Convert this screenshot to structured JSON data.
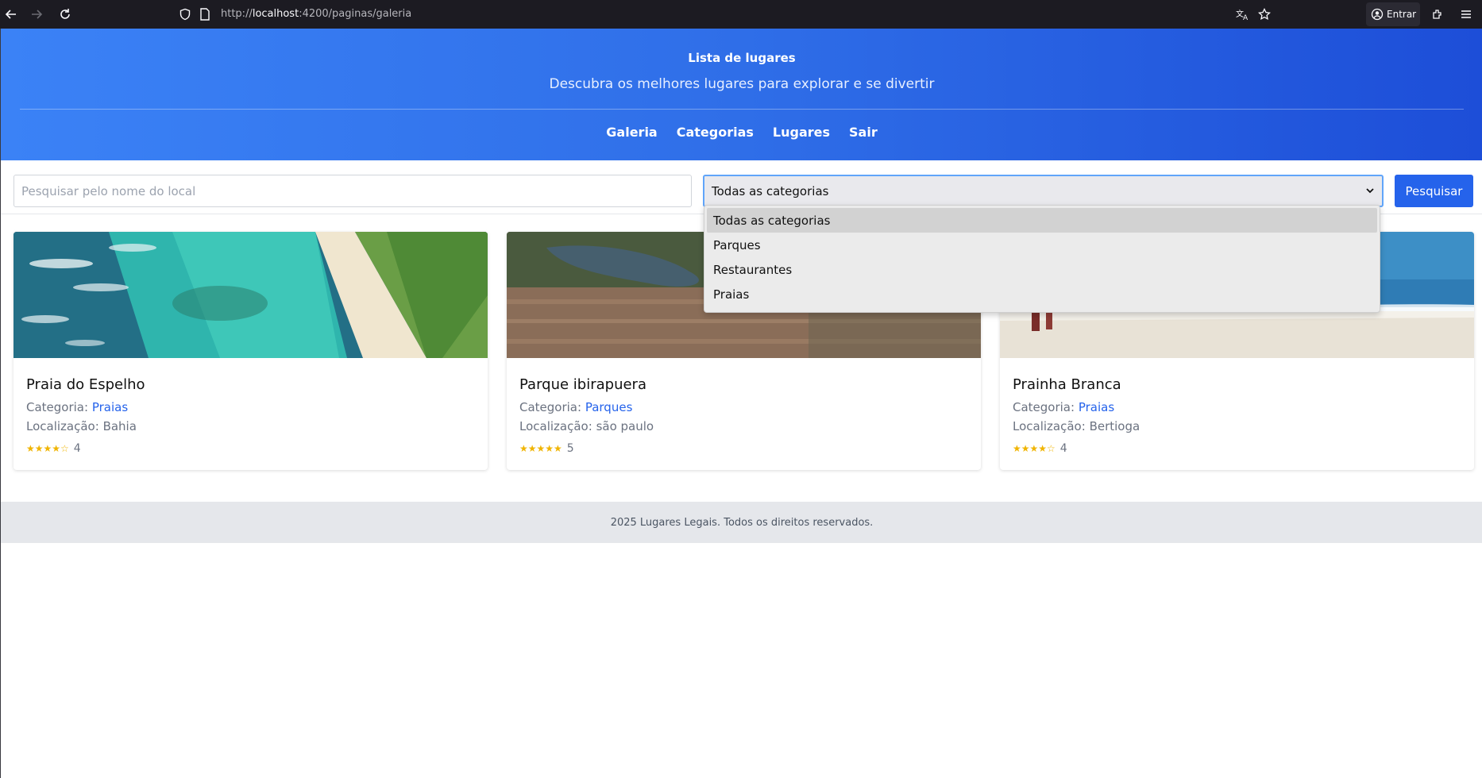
{
  "browser": {
    "url_prefix": "http://",
    "url_host": "localhost",
    "url_rest": ":4200/paginas/galeria",
    "account_label": "Entrar"
  },
  "header": {
    "title": "Lista de lugares",
    "subtitle": "Descubra os melhores lugares para explorar e se divertir",
    "menu": [
      {
        "label": "Galeria"
      },
      {
        "label": "Categorias"
      },
      {
        "label": "Lugares"
      },
      {
        "label": "Sair"
      }
    ]
  },
  "filters": {
    "search_placeholder": "Pesquisar pelo nome do local",
    "category_selected": "Todas as categorias",
    "category_options": [
      "Todas as categorias",
      "Parques",
      "Restaurantes",
      "Praias"
    ],
    "search_button": "Pesquisar"
  },
  "cards": [
    {
      "name": "Praia do Espelho",
      "category_label": "Categoria:",
      "category": "Praias",
      "location_label": "Localização:",
      "location": "Bahia",
      "stars": "★★★★☆",
      "rating": "4"
    },
    {
      "name": "Parque ibirapuera",
      "category_label": "Categoria:",
      "category": "Parques",
      "location_label": "Localização:",
      "location": "são paulo",
      "stars": "★★★★★",
      "rating": "5"
    },
    {
      "name": "Prainha Branca",
      "category_label": "Categoria:",
      "category": "Praias",
      "location_label": "Localização:",
      "location": "Bertioga",
      "stars": "★★★★☆",
      "rating": "4"
    }
  ],
  "footer": {
    "text": "2025 Lugares Legais. Todos os direitos reservados."
  },
  "colors": {
    "primary": "#2563eb",
    "hero_start": "#3b82f6",
    "hero_end": "#1d4ed8",
    "star": "#f0b400"
  }
}
